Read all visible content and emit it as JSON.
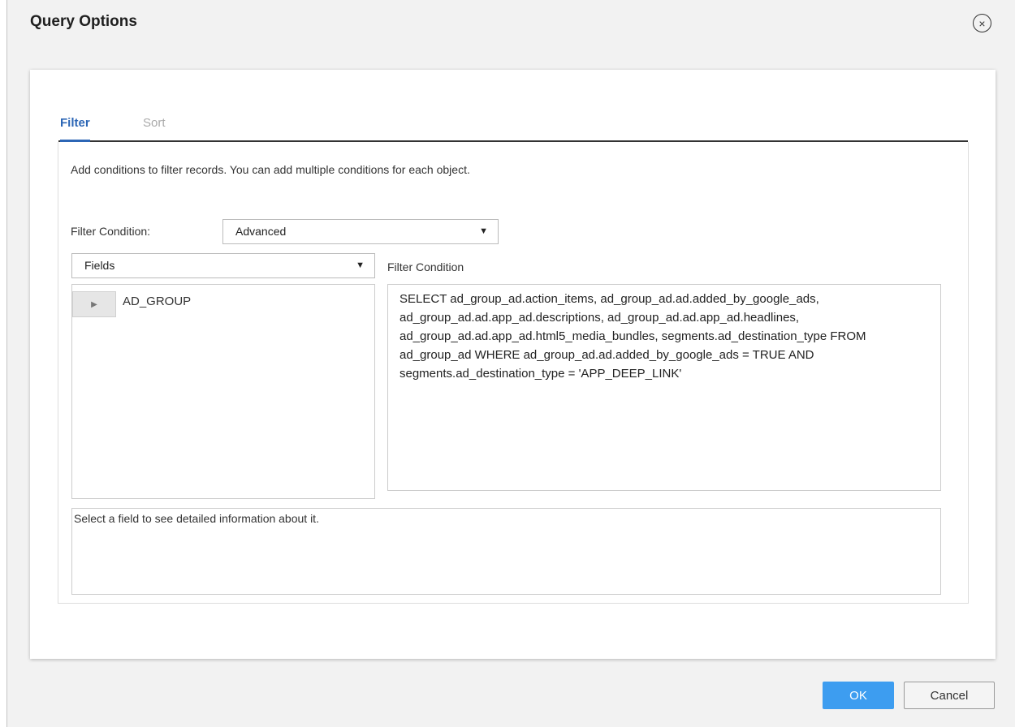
{
  "dialog": {
    "title": "Query Options",
    "close_glyph": "×"
  },
  "tabs": [
    {
      "label": "Filter",
      "active": true
    },
    {
      "label": "Sort",
      "active": false
    }
  ],
  "filter": {
    "description": "Add conditions to filter records. You can add multiple conditions for each object.",
    "condition_label": "Filter Condition:",
    "condition_mode": "Advanced",
    "fields_select": "Fields",
    "condition_editor_label": "Filter Condition",
    "fields": [
      {
        "name": "AD_GROUP",
        "expand_icon": "play-triangle-icon"
      }
    ],
    "query": "SELECT ad_group_ad.action_items, ad_group_ad.ad.added_by_google_ads, ad_group_ad.ad.app_ad.descriptions, ad_group_ad.ad.app_ad.headlines, ad_group_ad.ad.app_ad.html5_media_bundles, segments.ad_destination_type FROM ad_group_ad WHERE ad_group_ad.ad.added_by_google_ads = TRUE AND segments.ad_destination_type = 'APP_DEEP_LINK'",
    "field_info": "Select a field to see detailed information about it."
  },
  "buttons": {
    "ok": "OK",
    "cancel": "Cancel"
  },
  "colors": {
    "accent": "#2c66b5",
    "ok_button": "#3d9df0"
  }
}
